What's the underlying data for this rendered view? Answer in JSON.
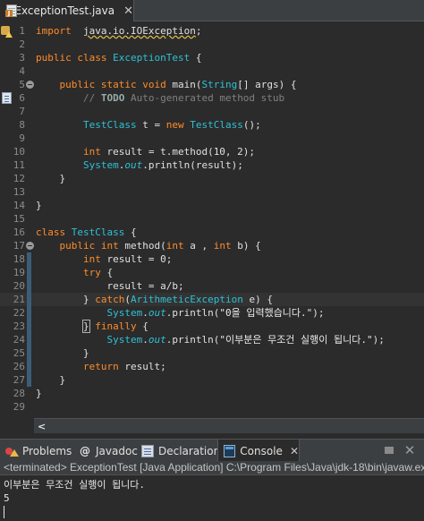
{
  "editor": {
    "tab_label": "ExceptionTest.java",
    "lines": [
      {
        "n": "1",
        "tokens": [
          [
            "kw",
            "import"
          ],
          [
            "",
            "  "
          ],
          [
            "squiggle",
            "java.io.IOException"
          ],
          [
            "",
            ";"
          ]
        ]
      },
      {
        "n": "2",
        "tokens": []
      },
      {
        "n": "3",
        "tokens": [
          [
            "kw",
            "public class"
          ],
          [
            "",
            " "
          ],
          [
            "cls",
            "ExceptionTest"
          ],
          [
            "",
            " {"
          ]
        ]
      },
      {
        "n": "4",
        "tokens": []
      },
      {
        "n": "5",
        "tokens": [
          [
            "",
            "    "
          ],
          [
            "kw",
            "public static void"
          ],
          [
            "",
            " "
          ],
          [
            "",
            "main("
          ],
          [
            "cls",
            "String"
          ],
          [
            "",
            "[] args) {"
          ]
        ]
      },
      {
        "n": "6",
        "tokens": [
          [
            "",
            "        "
          ],
          [
            "comment",
            "// "
          ],
          [
            "todo",
            "TODO"
          ],
          [
            "comment",
            " Auto-generated method stub"
          ]
        ]
      },
      {
        "n": "7",
        "tokens": []
      },
      {
        "n": "8",
        "tokens": [
          [
            "",
            "        "
          ],
          [
            "cls",
            "TestClass"
          ],
          [
            "",
            " t = "
          ],
          [
            "kw",
            "new"
          ],
          [
            "",
            " "
          ],
          [
            "cls",
            "TestClass"
          ],
          [
            "",
            "();"
          ]
        ]
      },
      {
        "n": "9",
        "tokens": []
      },
      {
        "n": "10",
        "tokens": [
          [
            "",
            "        "
          ],
          [
            "kw",
            "int"
          ],
          [
            "",
            " result = t.method(10, 2);"
          ]
        ]
      },
      {
        "n": "11",
        "tokens": [
          [
            "",
            "        "
          ],
          [
            "cls",
            "System"
          ],
          [
            "",
            "."
          ],
          [
            "field",
            "out"
          ],
          [
            "",
            ".println(result);"
          ]
        ]
      },
      {
        "n": "12",
        "tokens": [
          [
            "",
            "    }"
          ]
        ]
      },
      {
        "n": "13",
        "tokens": []
      },
      {
        "n": "14",
        "tokens": [
          [
            "",
            "}"
          ]
        ]
      },
      {
        "n": "15",
        "tokens": []
      },
      {
        "n": "16",
        "tokens": [
          [
            "kw",
            "class"
          ],
          [
            "",
            " "
          ],
          [
            "cls",
            "TestClass"
          ],
          [
            "",
            " {"
          ]
        ]
      },
      {
        "n": "17",
        "tokens": [
          [
            "",
            "    "
          ],
          [
            "kw",
            "public int"
          ],
          [
            "",
            " method("
          ],
          [
            "kw",
            "int"
          ],
          [
            "",
            " a , "
          ],
          [
            "kw",
            "int"
          ],
          [
            "",
            " b) {"
          ]
        ]
      },
      {
        "n": "18",
        "tokens": [
          [
            "",
            "        "
          ],
          [
            "kw",
            "int"
          ],
          [
            "",
            " result = 0;"
          ]
        ]
      },
      {
        "n": "19",
        "tokens": [
          [
            "",
            "        "
          ],
          [
            "kw",
            "try"
          ],
          [
            "",
            " {"
          ]
        ]
      },
      {
        "n": "20",
        "tokens": [
          [
            "",
            "            result = a/b;"
          ]
        ]
      },
      {
        "n": "21",
        "tokens": [
          [
            "",
            "        } "
          ],
          [
            "kw",
            "catch"
          ],
          [
            "",
            "("
          ],
          [
            "cls",
            "ArithmeticException"
          ],
          [
            "",
            " e) {"
          ]
        ]
      },
      {
        "n": "22",
        "tokens": [
          [
            "",
            "            "
          ],
          [
            "cls",
            "System"
          ],
          [
            "",
            "."
          ],
          [
            "field",
            "out"
          ],
          [
            "",
            ".println("
          ],
          [
            "str",
            "\"0을 입력했습니다.\""
          ],
          [
            "",
            ");"
          ]
        ]
      },
      {
        "n": "23",
        "tokens": [
          [
            "",
            "        "
          ],
          [
            "bracket-box",
            "}"
          ],
          [
            "",
            " "
          ],
          [
            "kw",
            "finally"
          ],
          [
            "",
            " {"
          ]
        ]
      },
      {
        "n": "24",
        "tokens": [
          [
            "",
            "            "
          ],
          [
            "cls",
            "System"
          ],
          [
            "",
            "."
          ],
          [
            "field",
            "out"
          ],
          [
            "",
            ".println("
          ],
          [
            "str",
            "\"이부분은 무조건 실행이 됩니다.\""
          ],
          [
            "",
            ");"
          ]
        ]
      },
      {
        "n": "25",
        "tokens": [
          [
            "",
            "        }"
          ]
        ]
      },
      {
        "n": "26",
        "tokens": [
          [
            "",
            "        "
          ],
          [
            "kw",
            "return"
          ],
          [
            "",
            " result;"
          ]
        ]
      },
      {
        "n": "27",
        "tokens": [
          [
            "",
            "    }"
          ]
        ]
      },
      {
        "n": "28",
        "tokens": [
          [
            "",
            "}"
          ]
        ]
      },
      {
        "n": "29",
        "tokens": []
      }
    ]
  },
  "panel": {
    "tabs": [
      {
        "label": "Problems",
        "icon": "problems-icon"
      },
      {
        "label": "Javadoc",
        "icon": "javadoc-icon"
      },
      {
        "label": "Declaration",
        "icon": "declaration-icon"
      },
      {
        "label": "Console",
        "icon": "console-icon",
        "active": true
      }
    ],
    "console_header": "<terminated> ExceptionTest [Java Application] C:\\Program Files\\Java\\jdk-18\\bin\\javaw.exe",
    "output_lines": [
      "이부분은 무조건 실행이 됩니다.",
      "5"
    ]
  }
}
